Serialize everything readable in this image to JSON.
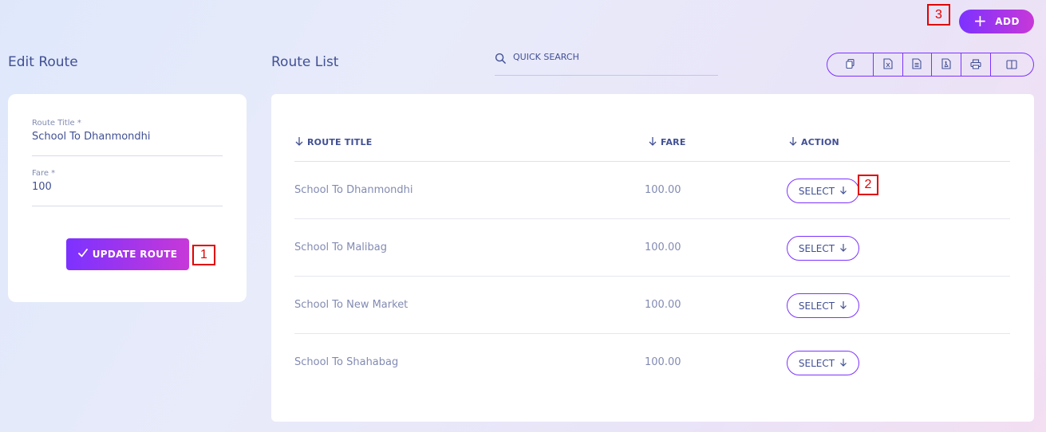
{
  "markers": {
    "m1": "1",
    "m2": "2",
    "m3": "3"
  },
  "header": {
    "add_label": "ADD"
  },
  "edit": {
    "title": "Edit Route",
    "route_title_label": "Route Title *",
    "route_title_value": "School To Dhanmondhi",
    "fare_label": "Fare *",
    "fare_value": "100",
    "update_label": "UPDATE ROUTE"
  },
  "list": {
    "title": "Route List",
    "search_placeholder": "QUICK SEARCH",
    "toolbar_icons": [
      "copy-icon",
      "excel-icon",
      "csv-icon",
      "pdf-icon",
      "print-icon",
      "columns-icon"
    ],
    "columns": {
      "route_title": "ROUTE TITLE",
      "fare": "FARE",
      "action": "ACTION"
    },
    "rows": [
      {
        "route_title": "School To Dhanmondhi",
        "fare": "100.00",
        "action": "SELECT"
      },
      {
        "route_title": "School To Malibag",
        "fare": "100.00",
        "action": "SELECT"
      },
      {
        "route_title": "School To New Market",
        "fare": "100.00",
        "action": "SELECT"
      },
      {
        "route_title": "School To Shahabag",
        "fare": "100.00",
        "action": "SELECT"
      }
    ]
  },
  "colors": {
    "accent_start": "#7c32ff",
    "accent_end": "#c738d8",
    "text": "#415094",
    "muted": "#828bb2"
  }
}
